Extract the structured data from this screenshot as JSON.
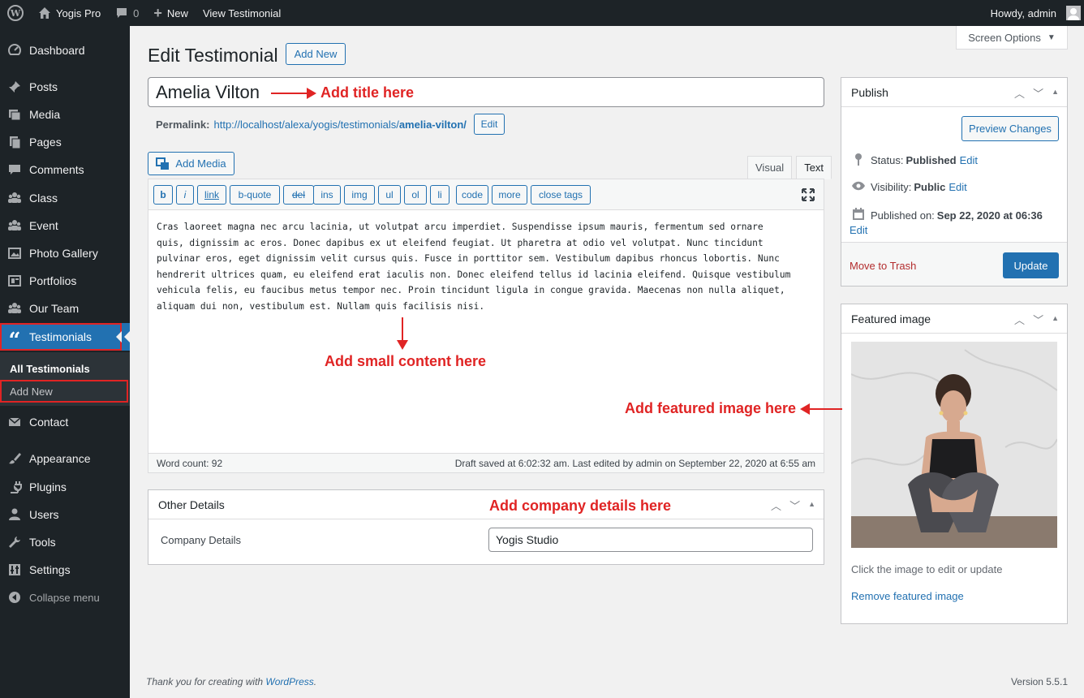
{
  "adminbar": {
    "site_name": "Yogis Pro",
    "comments_count": "0",
    "new_label": "New",
    "view_label": "View Testimonial",
    "howdy": "Howdy, admin"
  },
  "sidebar": {
    "items": [
      {
        "label": "Dashboard",
        "icon": "dashboard-icon"
      },
      {
        "label": "Posts",
        "icon": "pin-icon"
      },
      {
        "label": "Media",
        "icon": "media-icon"
      },
      {
        "label": "Pages",
        "icon": "pages-icon"
      },
      {
        "label": "Comments",
        "icon": "comment-icon"
      },
      {
        "label": "Class",
        "icon": "groups-icon"
      },
      {
        "label": "Event",
        "icon": "groups-icon"
      },
      {
        "label": "Photo Gallery",
        "icon": "gallery-icon"
      },
      {
        "label": "Portfolios",
        "icon": "portfolio-icon"
      },
      {
        "label": "Our Team",
        "icon": "groups-icon"
      },
      {
        "label": "Testimonials",
        "icon": "quote-icon"
      },
      {
        "label": "Contact",
        "icon": "mail-icon"
      },
      {
        "label": "Appearance",
        "icon": "brush-icon"
      },
      {
        "label": "Plugins",
        "icon": "plugin-icon"
      },
      {
        "label": "Users",
        "icon": "user-icon"
      },
      {
        "label": "Tools",
        "icon": "wrench-icon"
      },
      {
        "label": "Settings",
        "icon": "settings-icon"
      },
      {
        "label": "Collapse menu",
        "icon": "collapse-icon"
      }
    ],
    "submenu": {
      "all": "All Testimonials",
      "add_new": "Add New"
    }
  },
  "screen_options": "Screen Options",
  "page": {
    "title": "Edit Testimonial",
    "add_new": "Add New",
    "post_title": "Amelia Vilton",
    "permalink_label": "Permalink:",
    "permalink_base": "http://localhost/alexa/yogis/testimonials/",
    "permalink_slug": "amelia-vilton/",
    "permalink_edit": "Edit"
  },
  "annotations": {
    "title": "Add title here",
    "content": "Add small content here",
    "featured": "Add featured image here",
    "company": "Add company details here"
  },
  "editor": {
    "add_media": "Add Media",
    "tab_visual": "Visual",
    "tab_text": "Text",
    "buttons": [
      "b",
      "i",
      "link",
      "b-quote",
      "del",
      "ins",
      "img",
      "ul",
      "ol",
      "li",
      "code",
      "more",
      "close tags"
    ],
    "lines": [
      "Cras laoreet magna nec arcu lacinia, ut volutpat arcu imperdiet. Suspendisse ipsum mauris, fermentum sed ornare",
      "quis, dignissim ac eros. Donec dapibus ex ut eleifend feugiat. Ut pharetra at odio vel volutpat. Nunc tincidunt",
      "pulvinar eros, eget dignissim velit cursus quis. Fusce in porttitor sem. Vestibulum dapibus rhoncus lobortis. Nunc",
      "hendrerit ultrices quam, eu eleifend erat iaculis non. Donec eleifend tellus id lacinia eleifend. Quisque vestibulum",
      "vehicula felis, eu faucibus metus tempor nec. Proin tincidunt ligula in congue gravida. Maecenas non nulla aliquet,",
      "aliquam dui non, vestibulum est. Nullam quis facilisis nisi."
    ],
    "word_count": "Word count: 92",
    "draft_saved": "Draft saved at 6:02:32 am. Last edited by admin on September 22, 2020 at 6:55 am"
  },
  "other_details": {
    "title": "Other Details",
    "company_label": "Company Details",
    "company_value": "Yogis Studio"
  },
  "publish": {
    "title": "Publish",
    "preview": "Preview Changes",
    "status_label": "Status:",
    "status_value": "Published",
    "visibility_label": "Visibility:",
    "visibility_value": "Public",
    "published_label": "Published on:",
    "published_value": "Sep 22, 2020 at 06:36",
    "edit": "Edit",
    "trash": "Move to Trash",
    "update": "Update"
  },
  "featured": {
    "title": "Featured image",
    "hint": "Click the image to edit or update",
    "remove": "Remove featured image"
  },
  "footer": {
    "thanks_prefix": "Thank you for creating with ",
    "thanks_link": "WordPress",
    "thanks_suffix": ".",
    "version": "Version 5.5.1"
  },
  "colors": {
    "accent": "#2271b1",
    "annotation": "#e02424",
    "sidebar": "#1d2327"
  }
}
